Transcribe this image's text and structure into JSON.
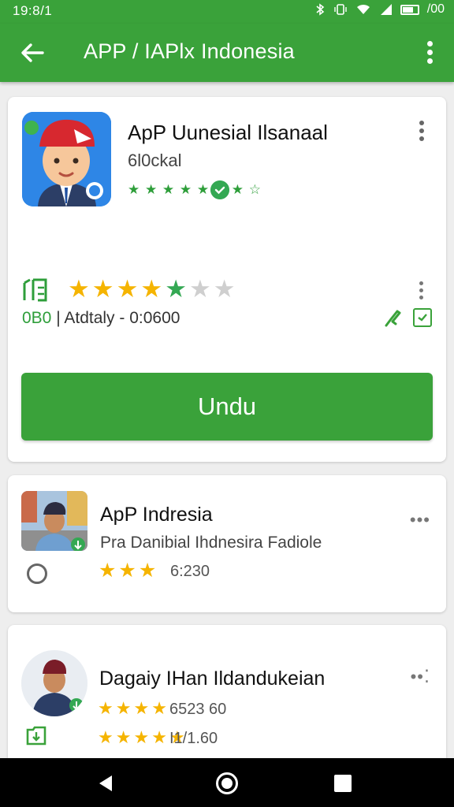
{
  "status_bar": {
    "time": "19:8/1",
    "battery_text": "/00"
  },
  "app_bar": {
    "title": "APP / IAPlx Indonesia"
  },
  "featured_app": {
    "name": "ApP Uunesial Ilsanaal",
    "developer": "6l0ckal",
    "mini_stars": "★ ★ ★ ★ ★ ★ ★ ☆",
    "rating_stars": 5,
    "empty_stars": 2,
    "info_code": "0B0",
    "info_text": "| Atdtaly - 0:0600",
    "install_label": "Undu"
  },
  "list": [
    {
      "name": "ApP Indresia",
      "subtitle": "Pra Danibial Ihdnesira Fadiole",
      "stars": 3,
      "count": "6:230",
      "more": "•••"
    },
    {
      "name": "Dagaiy IHan Ildandukeian",
      "stars_row1": 4,
      "count_row1": "6523 60",
      "stars_row2": 5,
      "count_row2": "I1/1.60",
      "more": "••⁚"
    }
  ],
  "colors": {
    "brand_green": "#3aa23a",
    "star_gold": "#f5b400",
    "star_green": "#34a853",
    "star_empty": "#cfcfcf",
    "icon_blue": "#2e86e6"
  },
  "icons": [
    "bluetooth-icon",
    "vibrate-icon",
    "wifi-icon",
    "signal-icon",
    "battery-icon",
    "back-arrow-icon",
    "more-vert-icon",
    "verified-badge-icon",
    "rating-icon",
    "edit-icon",
    "checkbox-icon",
    "history-icon",
    "download-box-icon",
    "nav-back-icon",
    "nav-home-icon",
    "nav-recents-icon"
  ]
}
